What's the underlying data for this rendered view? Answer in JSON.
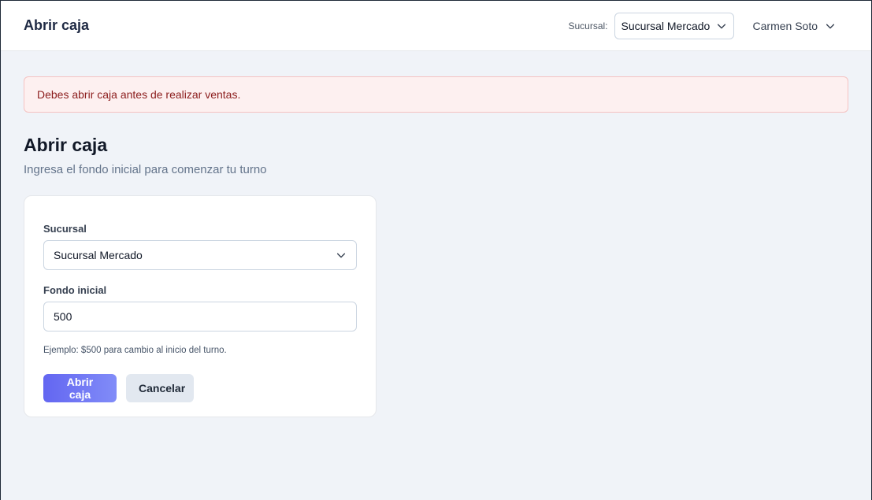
{
  "header": {
    "title": "Abrir caja",
    "branch_label": "Sucursal:",
    "branch_selected": "Sucursal Mercado",
    "user_name": "Carmen Soto"
  },
  "alert": {
    "message": "Debes abrir caja antes de realizar ventas."
  },
  "page": {
    "title": "Abrir caja",
    "subtitle": "Ingresa el fondo inicial para comenzar tu turno"
  },
  "form": {
    "branch_label": "Sucursal",
    "branch_selected": "Sucursal Mercado",
    "fund_label": "Fondo inicial",
    "fund_value": "500",
    "hint": "Ejemplo: $500 para cambio al inicio del turno.",
    "submit_label": "Abrir caja",
    "cancel_label": "Cancelar"
  },
  "icons": {
    "branch_dropdown": "chevron-down-icon",
    "user_dropdown": "chevron-down-icon",
    "form_branch_dropdown": "chevron-down-icon"
  },
  "colors": {
    "accent": "#6366f1",
    "alert_bg": "#fdf0f0",
    "alert_text": "#8b1c1c"
  }
}
